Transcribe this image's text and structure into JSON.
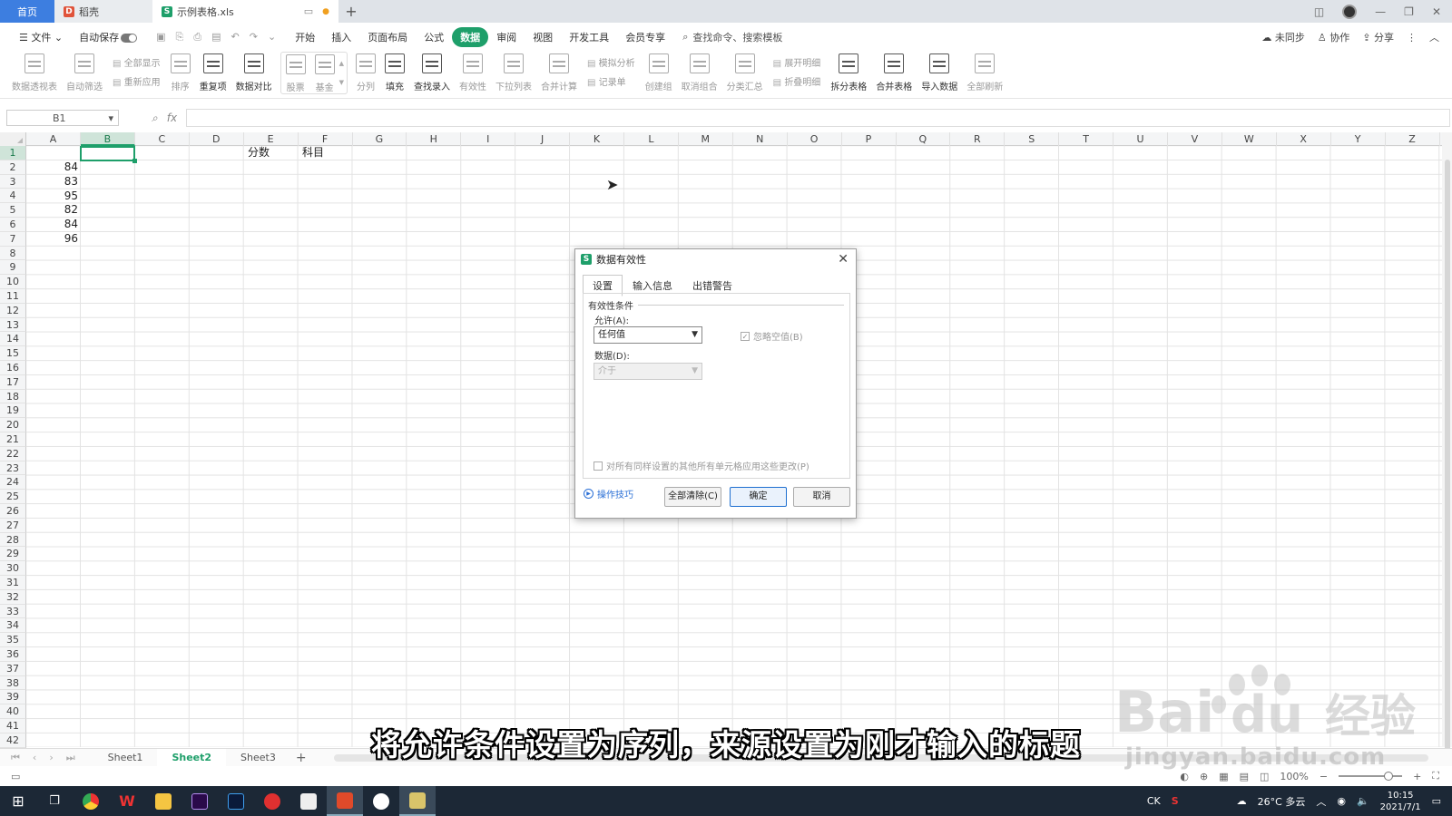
{
  "tabs": {
    "home": "首页",
    "docer": "稻壳",
    "file": "示例表格.xls",
    "add": "+"
  },
  "menu": {
    "file": "文件",
    "autosave": "自动保存",
    "items": [
      "开始",
      "插入",
      "页面布局",
      "公式",
      "数据",
      "审阅",
      "视图",
      "开发工具",
      "会员专享"
    ],
    "active": "数据",
    "search": "查找命令、搜索模板",
    "sync": "未同步",
    "collab": "协作",
    "share": "分享"
  },
  "ribbon": {
    "pivot": "数据透视表",
    "autofilter": "自动筛选",
    "show_all": "全部显示",
    "reapply": "重新应用",
    "sort": "排序",
    "duplicates": "重复项",
    "compare": "数据对比",
    "stock": "股票",
    "fund": "基金",
    "split": "分列",
    "fill": "填充",
    "lookup": "查找录入",
    "validity": "有效性",
    "dropdown": "下拉列表",
    "consolidate": "合并计算",
    "simulate": "模拟分析",
    "record": "记录单",
    "group": "创建组",
    "ungroup": "取消组合",
    "subtotal": "分类汇总",
    "expand": "展开明细",
    "collapse": "折叠明细",
    "split_table": "拆分表格",
    "merge_table": "合并表格",
    "import": "导入数据",
    "refresh": "全部刷新"
  },
  "formula_bar": {
    "namebox": "B1",
    "fx": "fx"
  },
  "sheet": {
    "columns": [
      "A",
      "B",
      "C",
      "D",
      "E",
      "F",
      "G",
      "H",
      "I",
      "J",
      "K",
      "L",
      "M",
      "N",
      "O",
      "P",
      "Q",
      "R",
      "S",
      "T",
      "U",
      "V",
      "W",
      "X",
      "Y",
      "Z"
    ],
    "selected_column": "B",
    "rows": [
      "1",
      "2",
      "3",
      "4",
      "5",
      "6",
      "7",
      "8",
      "9",
      "10",
      "11",
      "12",
      "13",
      "14",
      "15",
      "16",
      "17",
      "18",
      "19",
      "20",
      "21",
      "22",
      "23",
      "24",
      "25",
      "26",
      "27",
      "28",
      "29",
      "30",
      "31",
      "32",
      "33",
      "34",
      "35",
      "36",
      "37",
      "38",
      "39",
      "40",
      "41",
      "42"
    ],
    "col_a_values": [
      "84",
      "83",
      "95",
      "82",
      "84",
      "96"
    ],
    "e1": "分数",
    "f1": "科目"
  },
  "sheet_tabs": {
    "tabs": [
      "Sheet1",
      "Sheet2",
      "Sheet3"
    ],
    "active": "Sheet2"
  },
  "status": {
    "zoom": "100%"
  },
  "dialog": {
    "title": "数据有效性",
    "tabs": [
      "设置",
      "输入信息",
      "出错警告"
    ],
    "active_tab": "设置",
    "section": "有效性条件",
    "allow_label": "允许(A):",
    "allow_value": "任何值",
    "ignore_blank": "忽略空值(B)",
    "data_label": "数据(D):",
    "data_value": "介于",
    "apply_all": "对所有同样设置的其他所有单元格应用这些更改(P)",
    "tips": "操作技巧",
    "clear_all": "全部清除(C)",
    "ok": "确定",
    "cancel": "取消"
  },
  "subtitle": "将允许条件设置为序列，来源设置为刚才输入的标题",
  "watermark": {
    "brand": "Bai",
    "brand2": "du",
    "cn": "经验",
    "url": "jingyan.baidu.com"
  },
  "taskbar": {
    "ime": "CK",
    "weather": "26°C 多云",
    "time": "10:15",
    "date": "2021/7/1"
  },
  "icons": [
    "menu-icon",
    "undo-icon",
    "redo-icon",
    "search-icon",
    "close-icon",
    "dropdown-arrow-icon",
    "windows-start-icon",
    "cloud-icon"
  ],
  "colors": {
    "accent": "#1e9f6a",
    "home_tab": "#3d7ee0",
    "taskbar": "#1c2836",
    "link": "#2a6fd6"
  }
}
